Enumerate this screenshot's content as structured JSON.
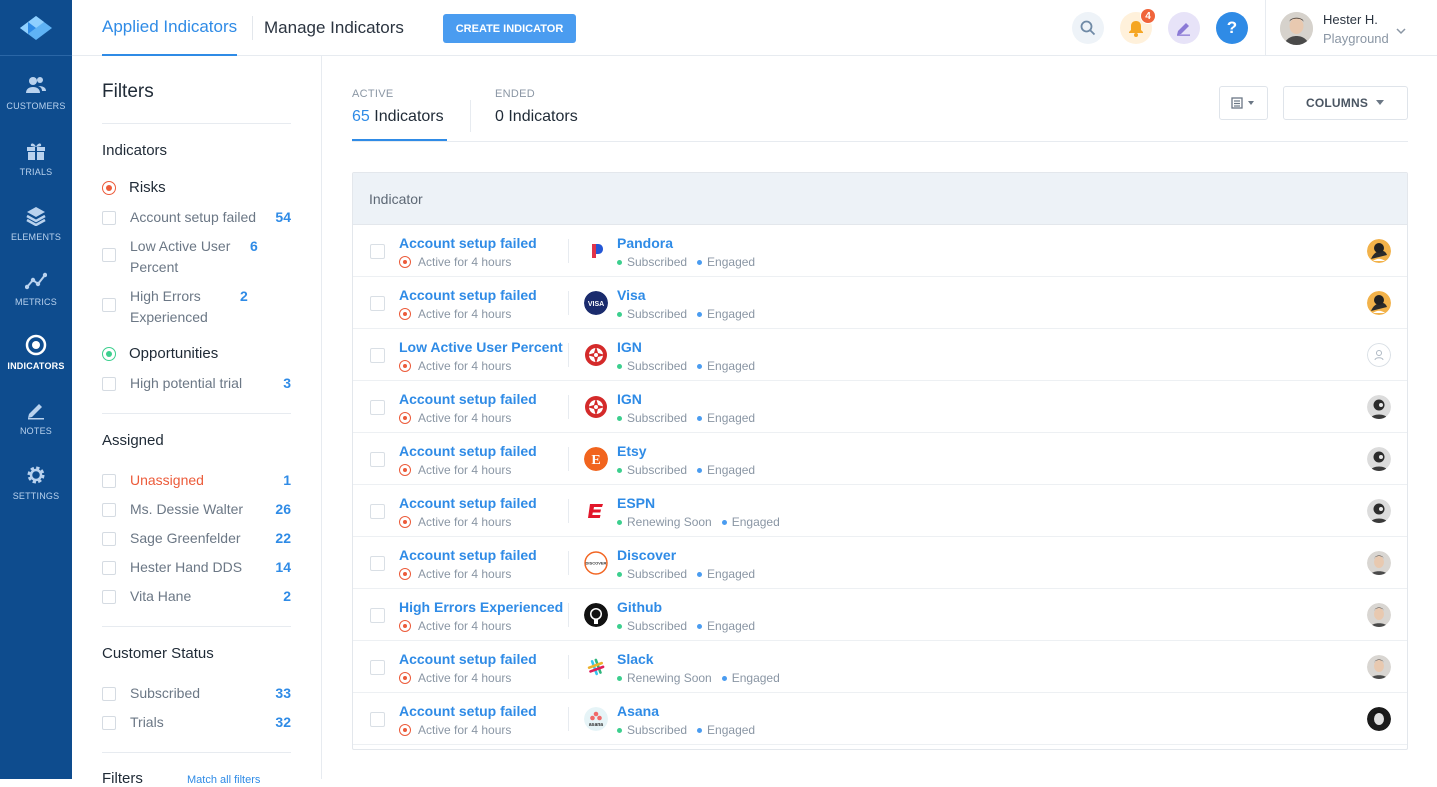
{
  "nav": {
    "items": [
      {
        "label": "CUSTOMERS",
        "icon": "customers-icon"
      },
      {
        "label": "TRIALS",
        "icon": "gift-icon"
      },
      {
        "label": "ELEMENTS",
        "icon": "layers-icon"
      },
      {
        "label": "METRICS",
        "icon": "metrics-icon"
      },
      {
        "label": "INDICATORS",
        "icon": "target-icon"
      },
      {
        "label": "NOTES",
        "icon": "pencil-icon"
      },
      {
        "label": "SETTINGS",
        "icon": "gear-icon"
      }
    ],
    "active": "INDICATORS"
  },
  "topbar": {
    "tabs": [
      "Applied Indicators",
      "Manage Indicators"
    ],
    "create_label": "CREATE INDICATOR",
    "notifications_count": "4",
    "help_label": "?",
    "user_name": "Hester H.",
    "user_org": "Playground"
  },
  "filters": {
    "title": "Filters",
    "indicators_heading": "Indicators",
    "risks_label": "Risks",
    "risks": [
      {
        "label": "Account setup failed",
        "count": "54"
      },
      {
        "label": "Low Active User Percent",
        "count": "6"
      },
      {
        "label": "High Errors Experienced",
        "count": "2"
      }
    ],
    "opportunities_label": "Opportunities",
    "opportunities": [
      {
        "label": "High potential trial",
        "count": "3"
      }
    ],
    "assigned_heading": "Assigned",
    "assigned": [
      {
        "label": "Unassigned",
        "count": "1"
      },
      {
        "label": "Ms. Dessie Walter",
        "count": "26"
      },
      {
        "label": "Sage Greenfelder",
        "count": "22"
      },
      {
        "label": "Hester Hand DDS",
        "count": "14"
      },
      {
        "label": "Vita Hane",
        "count": "2"
      }
    ],
    "status_heading": "Customer Status",
    "status": [
      {
        "label": "Subscribed",
        "count": "33"
      },
      {
        "label": "Trials",
        "count": "32"
      }
    ],
    "more_heading": "Filters",
    "match_label": "Match all filters"
  },
  "main": {
    "tabs": [
      {
        "key": "ACTIVE",
        "count": "65",
        "label": "Indicators"
      },
      {
        "key": "ENDED",
        "count": "0",
        "label": "Indicators"
      }
    ],
    "columns_label": "COLUMNS",
    "table_header": "Indicator",
    "rows": [
      {
        "indicator": "Account setup failed",
        "duration": "Active for 4 hours",
        "company": "Pandora",
        "logo": "pandora",
        "status": "Subscribed",
        "engagement": "Engaged",
        "avatar": "avatar-a"
      },
      {
        "indicator": "Account setup failed",
        "duration": "Active for 4 hours",
        "company": "Visa",
        "logo": "visa",
        "status": "Subscribed",
        "engagement": "Engaged",
        "avatar": "avatar-a"
      },
      {
        "indicator": "Low Active User Percent",
        "duration": "Active for 4 hours",
        "company": "IGN",
        "logo": "ign",
        "status": "Subscribed",
        "engagement": "Engaged",
        "avatar": "avatar-none"
      },
      {
        "indicator": "Account setup failed",
        "duration": "Active for 4 hours",
        "company": "IGN",
        "logo": "ign",
        "status": "Subscribed",
        "engagement": "Engaged",
        "avatar": "avatar-b"
      },
      {
        "indicator": "Account setup failed",
        "duration": "Active for 4 hours",
        "company": "Etsy",
        "logo": "etsy",
        "status": "Subscribed",
        "engagement": "Engaged",
        "avatar": "avatar-b"
      },
      {
        "indicator": "Account setup failed",
        "duration": "Active for 4 hours",
        "company": "ESPN",
        "logo": "espn",
        "status": "Renewing Soon",
        "engagement": "Engaged",
        "avatar": "avatar-b"
      },
      {
        "indicator": "Account setup failed",
        "duration": "Active for 4 hours",
        "company": "Discover",
        "logo": "discover",
        "status": "Subscribed",
        "engagement": "Engaged",
        "avatar": "avatar-c"
      },
      {
        "indicator": "High Errors Experienced",
        "duration": "Active for 4 hours",
        "company": "Github",
        "logo": "github",
        "status": "Subscribed",
        "engagement": "Engaged",
        "avatar": "avatar-c"
      },
      {
        "indicator": "Account setup failed",
        "duration": "Active for 4 hours",
        "company": "Slack",
        "logo": "slack",
        "status": "Renewing Soon",
        "engagement": "Engaged",
        "avatar": "avatar-c"
      },
      {
        "indicator": "Account setup failed",
        "duration": "Active for 4 hours",
        "company": "Asana",
        "logo": "asana",
        "status": "Subscribed",
        "engagement": "Engaged",
        "avatar": "avatar-d"
      }
    ]
  },
  "colors": {
    "nav_bg": "#0e4c8e",
    "accent": "#2f8be6",
    "risk": "#ec5b3a",
    "opportunity": "#3ccf8e",
    "engaged_dot": "#4a9cf0"
  }
}
